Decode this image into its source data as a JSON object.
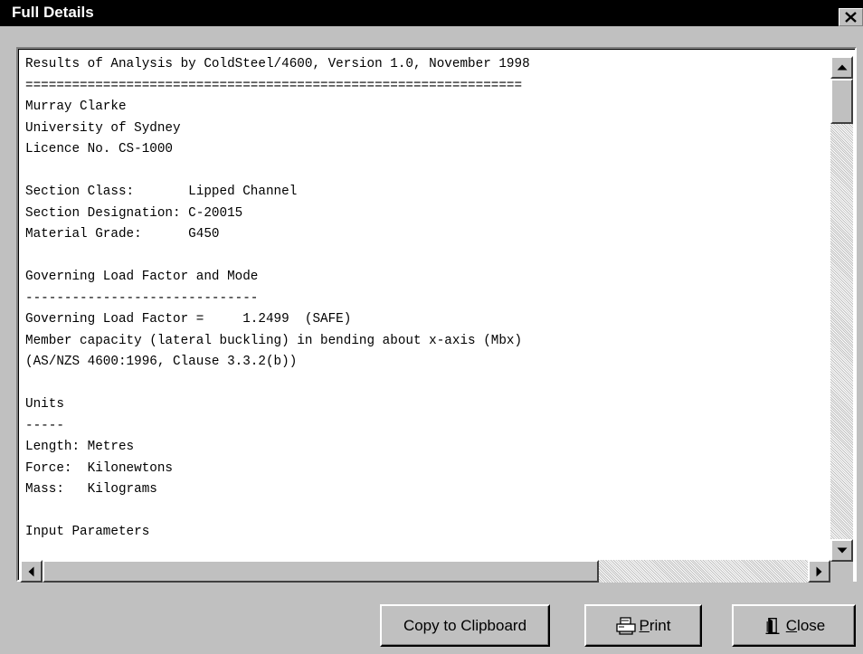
{
  "window": {
    "title": "Full Details",
    "close_glyph": "close-icon"
  },
  "report": {
    "lines": [
      "Results of Analysis by ColdSteel/4600, Version 1.0, November 1998",
      "================================================================",
      "Murray Clarke",
      "University of Sydney",
      "Licence No. CS-1000",
      "",
      "Section Class:       Lipped Channel",
      "Section Designation: C-20015",
      "Material Grade:      G450",
      "",
      "Governing Load Factor and Mode",
      "------------------------------",
      "Governing Load Factor =     1.2499  (SAFE)",
      "Member capacity (lateral buckling) in bending about x-axis (Mbx)",
      "(AS/NZS 4600:1996, Clause 3.3.2(b))",
      "",
      "Units",
      "-----",
      "Length: Metres",
      "Force:  Kilonewtons",
      "Mass:   Kilograms",
      "",
      "Input Parameters",
      "----------------"
    ]
  },
  "buttons": {
    "copy_label": "Copy to Clipboard",
    "print_label_underlined": "P",
    "print_label_rest": "rint",
    "close_label_underlined": "C",
    "close_label_rest": "lose",
    "print_icon": "printer-icon",
    "close_icon": "door-exit-icon"
  },
  "colors": {
    "titlebar": "#000000",
    "face": "#c0c0c0",
    "textbox": "#ffffff"
  }
}
